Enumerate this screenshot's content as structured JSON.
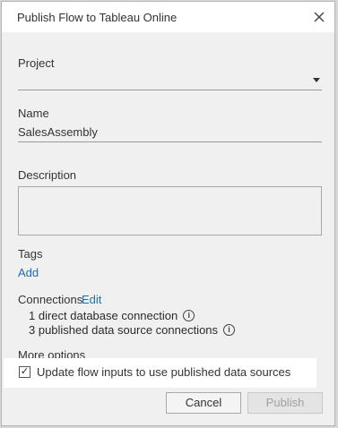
{
  "dialog": {
    "title": "Publish Flow to Tableau Online",
    "close_icon": "close-icon"
  },
  "project": {
    "label": "Project",
    "value": ""
  },
  "name": {
    "label": "Name",
    "value": "SalesAssembly"
  },
  "description": {
    "label": "Description",
    "value": ""
  },
  "tags": {
    "label": "Tags",
    "add_link": "Add"
  },
  "connections": {
    "label": "Connections",
    "edit_link": "Edit",
    "items": [
      {
        "text": "1 direct database connection",
        "icon": "info-icon"
      },
      {
        "text": "3 published data source connections",
        "icon": "info-icon"
      }
    ]
  },
  "more_options": {
    "label": "More options",
    "checkbox_label": "Update flow inputs to use published data sources",
    "checked": true
  },
  "buttons": {
    "cancel": "Cancel",
    "publish": "Publish"
  },
  "colors": {
    "link": "#1f6fb5",
    "dialog_bg": "#f0f0f0",
    "highlight_bg": "#ffffff"
  }
}
